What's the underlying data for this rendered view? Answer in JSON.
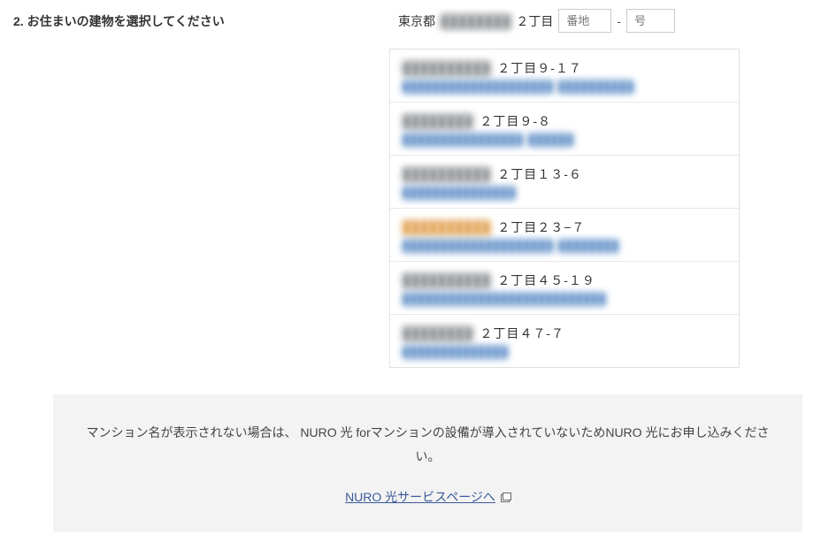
{
  "step": {
    "number": "2.",
    "title": "お住まいの建物を選択してください"
  },
  "address": {
    "prefix": "東京都",
    "obscured": "████████",
    "chome": "２丁目",
    "banchi_placeholder": "番地",
    "dash": "-",
    "go_placeholder": "号"
  },
  "buildings": [
    {
      "name_blur": "██████████",
      "addr": "２丁目９-１７",
      "sub_blur1": "████████████████████",
      "sub_blur2": "██████████"
    },
    {
      "name_blur": "████████",
      "addr": "２丁目９-８",
      "sub_blur1": "████████████████",
      "sub_blur2": "██████"
    },
    {
      "name_blur": "██████████",
      "addr": "２丁目１３-６",
      "sub_blur1": "███████████████",
      "sub_blur2": ""
    },
    {
      "name_blur": "██████████",
      "addr": "２丁目２３−７",
      "sub_blur1": "████████████████████",
      "sub_blur2": "████████",
      "orange": true
    },
    {
      "name_blur": "██████████",
      "addr": "２丁目４５-１９",
      "sub_blur1": "███████████████████████████",
      "sub_blur2": ""
    },
    {
      "name_blur": "████████",
      "addr": "２丁目４７-７",
      "sub_blur1": "██████████████",
      "sub_blur2": ""
    }
  ],
  "notice": {
    "text": "マンション名が表示されない場合は、 NURO 光 forマンションの設備が導入されていないためNURO 光にお申し込みください。",
    "link": "NURO 光サービスページへ"
  }
}
